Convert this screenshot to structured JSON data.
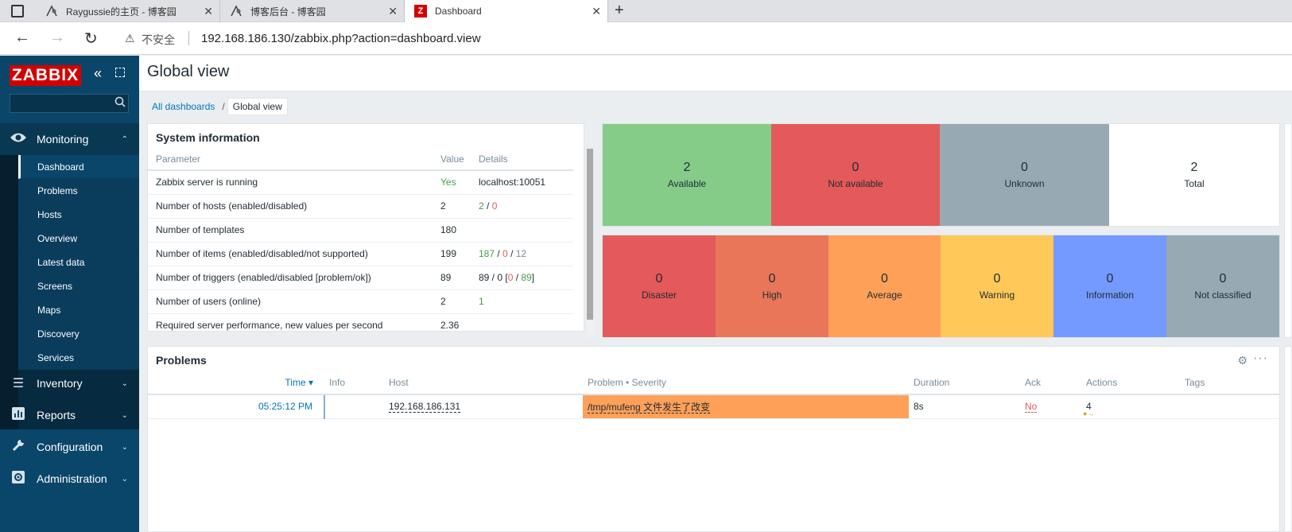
{
  "browser": {
    "tabs": [
      {
        "title": "Raygussie的主页 - 博客园"
      },
      {
        "title": "博客后台 - 博客园"
      },
      {
        "title": "Dashboard"
      }
    ],
    "security_label": "不安全",
    "url": "192.168.186.130/zabbix.php?action=dashboard.view"
  },
  "sidebar": {
    "logo": "ZABBIX",
    "sections": {
      "monitoring": "Monitoring",
      "inventory": "Inventory",
      "reports": "Reports",
      "configuration": "Configuration",
      "administration": "Administration"
    },
    "monitoring_items": [
      "Dashboard",
      "Problems",
      "Hosts",
      "Overview",
      "Latest data",
      "Screens",
      "Maps",
      "Discovery",
      "Services"
    ]
  },
  "page": {
    "title": "Global view",
    "breadcrumb_all": "All dashboards",
    "breadcrumb_current": "Global view"
  },
  "system_info": {
    "title": "System information",
    "headers": {
      "parameter": "Parameter",
      "value": "Value",
      "details": "Details"
    },
    "rows": [
      {
        "param": "Zabbix server is running",
        "value": "Yes",
        "d1": "localhost:10051"
      },
      {
        "param": "Number of hosts (enabled/disabled)",
        "value": "2",
        "d1": "2",
        "s1": " / ",
        "d2": "0"
      },
      {
        "param": "Number of templates",
        "value": "180"
      },
      {
        "param": "Number of items (enabled/disabled/not supported)",
        "value": "199",
        "d1": "187",
        "s1": " / ",
        "d2": "0",
        "s2": " / ",
        "d3": "12"
      },
      {
        "param": "Number of triggers (enabled/disabled [problem/ok])",
        "value": "89",
        "d1": "89 / 0 [",
        "d2": "0",
        "s2": " / ",
        "d3": "89",
        "s3": "]"
      },
      {
        "param": "Number of users (online)",
        "value": "2",
        "d1": "1"
      },
      {
        "param": "Required server performance, new values per second",
        "value": "2.36"
      }
    ]
  },
  "host_availability": [
    {
      "count": "2",
      "label": "Available",
      "color": "#86cc89"
    },
    {
      "count": "0",
      "label": "Not available",
      "color": "#e45959"
    },
    {
      "count": "0",
      "label": "Unknown",
      "color": "#97aab3"
    },
    {
      "count": "2",
      "label": "Total",
      "color": "#ffffff"
    }
  ],
  "severities": [
    {
      "count": "0",
      "label": "Disaster",
      "color": "#e45959"
    },
    {
      "count": "0",
      "label": "High",
      "color": "#e97659"
    },
    {
      "count": "0",
      "label": "Average",
      "color": "#ffa059"
    },
    {
      "count": "0",
      "label": "Warning",
      "color": "#ffc859"
    },
    {
      "count": "0",
      "label": "Information",
      "color": "#7499ff"
    },
    {
      "count": "0",
      "label": "Not classified",
      "color": "#97aab3"
    }
  ],
  "problems": {
    "title": "Problems",
    "headers": {
      "time": "Time ▾",
      "info": "Info",
      "host": "Host",
      "problem": "Problem • Severity",
      "duration": "Duration",
      "ack": "Ack",
      "actions": "Actions",
      "tags": "Tags"
    },
    "rows": [
      {
        "time": "05:25:12 PM",
        "host": "192.168.186.131",
        "problem": "/tmp/mufeng 文件发生了改变",
        "duration": "8s",
        "ack": "No",
        "actions": "4"
      }
    ]
  }
}
